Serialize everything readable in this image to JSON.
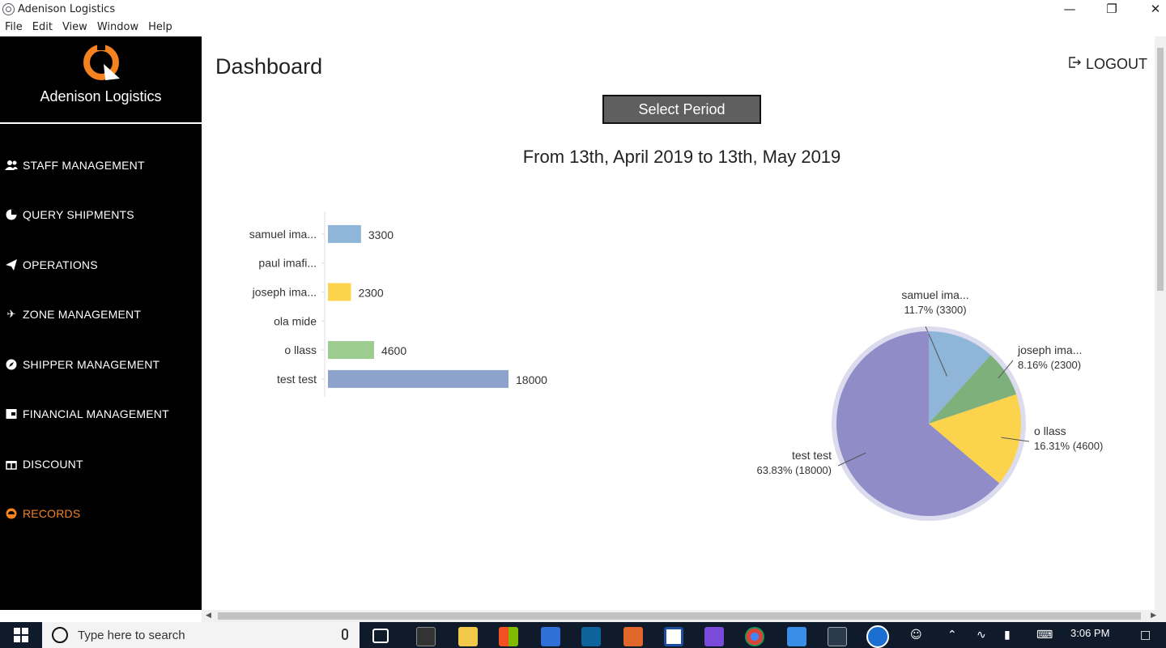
{
  "window": {
    "title": "Adenison Logistics",
    "menu": [
      "File",
      "Edit",
      "View",
      "Window",
      "Help"
    ]
  },
  "sidebar": {
    "brand": "Adenison Logistics",
    "items": [
      {
        "label": "STAFF MANAGEMENT",
        "icon": "users-icon"
      },
      {
        "label": "QUERY SHIPMENTS",
        "icon": "pie-icon"
      },
      {
        "label": "OPERATIONS",
        "icon": "paper-plane-icon"
      },
      {
        "label": "ZONE MANAGEMENT",
        "icon": "airplane-icon"
      },
      {
        "label": "SHIPPER MANAGEMENT",
        "icon": "compass-icon"
      },
      {
        "label": "FINANCIAL MANAGEMENT",
        "icon": "wallet-icon"
      },
      {
        "label": "DISCOUNT",
        "icon": "gift-icon"
      },
      {
        "label": "RECORDS",
        "icon": "records-icon",
        "active": true
      }
    ],
    "accent": "#f5821f"
  },
  "main": {
    "title": "Dashboard",
    "logout": "LOGOUT",
    "select_period": "Select Period",
    "period_text": "From 13th, April 2019 to 13th, May 2019"
  },
  "chart_data": [
    {
      "type": "bar",
      "orientation": "horizontal",
      "categories": [
        "samuel ima...",
        "paul imafi...",
        "joseph ima...",
        "ola mide",
        "o llass",
        "test test"
      ],
      "values": [
        3300,
        0,
        2300,
        0,
        4600,
        18000
      ],
      "value_labels": [
        "3300",
        "",
        "2300",
        "",
        "4600",
        "18000"
      ],
      "colors": [
        "#8fb5d9",
        "#8fb5d9",
        "#fcd34d",
        "#fcd34d",
        "#9ccc8f",
        "#8ea3cc"
      ],
      "title": "",
      "xlabel": "",
      "ylabel": ""
    },
    {
      "type": "pie",
      "slices": [
        {
          "label": "samuel ima...",
          "value": 3300,
          "pct_label": "11.7% (3300)",
          "color": "#8fb5d9"
        },
        {
          "label": "joseph ima...",
          "value": 2300,
          "pct_label": "8.16% (2300)",
          "color": "#7db07a"
        },
        {
          "label": "o llass",
          "value": 4600,
          "pct_label": "16.31% (4600)",
          "color": "#fcd34d"
        },
        {
          "label": "test test",
          "value": 18000,
          "pct_label": "63.83% (18000)",
          "color": "#8f8cc8"
        }
      ]
    }
  ],
  "taskbar": {
    "search_placeholder": "Type here to search",
    "time": "3:06 PM"
  }
}
